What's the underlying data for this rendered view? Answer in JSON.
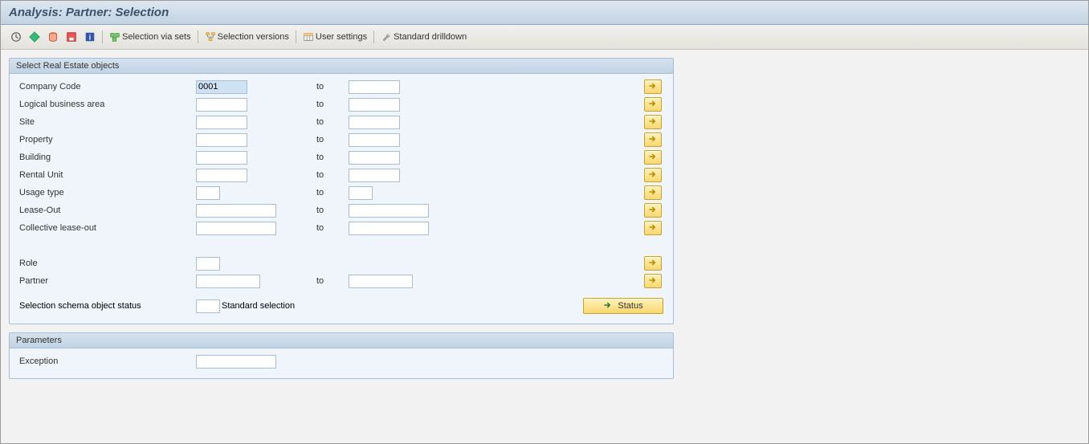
{
  "title": "Analysis: Partner: Selection",
  "toolbar": {
    "selection_via_sets_label": "Selection via sets",
    "selection_versions_label": "Selection versions",
    "user_settings_label": "User settings",
    "standard_drilldown_label": "Standard drilldown"
  },
  "panel1": {
    "title": "Select Real Estate objects",
    "rows": [
      {
        "key": "company_code",
        "label": "Company Code",
        "from": "0001",
        "to": "",
        "fw": "w64",
        "tw": "w64",
        "selected": true
      },
      {
        "key": "logical_business_area",
        "label": "Logical business area",
        "from": "",
        "to": "",
        "fw": "w64",
        "tw": "w64"
      },
      {
        "key": "site",
        "label": "Site",
        "from": "",
        "to": "",
        "fw": "w64",
        "tw": "w64"
      },
      {
        "key": "property",
        "label": "Property",
        "from": "",
        "to": "",
        "fw": "w64",
        "tw": "w64"
      },
      {
        "key": "building",
        "label": "Building",
        "from": "",
        "to": "",
        "fw": "w64",
        "tw": "w64"
      },
      {
        "key": "rental_unit",
        "label": "Rental Unit",
        "from": "",
        "to": "",
        "fw": "w64",
        "tw": "w64"
      },
      {
        "key": "usage_type",
        "label": "Usage type",
        "from": "",
        "to": "",
        "fw": "w30",
        "tw": "w30"
      },
      {
        "key": "lease_out",
        "label": "Lease-Out",
        "from": "",
        "to": "",
        "fw": "w100",
        "tw": "w100"
      },
      {
        "key": "collective_lease_out",
        "label": "Collective lease-out",
        "from": "",
        "to": "",
        "fw": "w100",
        "tw": "w100"
      }
    ],
    "role_label": "Role",
    "role": "",
    "partner_label": "Partner",
    "partner_from": "",
    "partner_to": "",
    "to_label": "to",
    "selection_schema_label": "Selection schema object status",
    "standard_selection_label": "Standard selection",
    "status_button_label": "Status"
  },
  "panel2": {
    "title": "Parameters",
    "exception_label": "Exception",
    "exception_value": ""
  }
}
